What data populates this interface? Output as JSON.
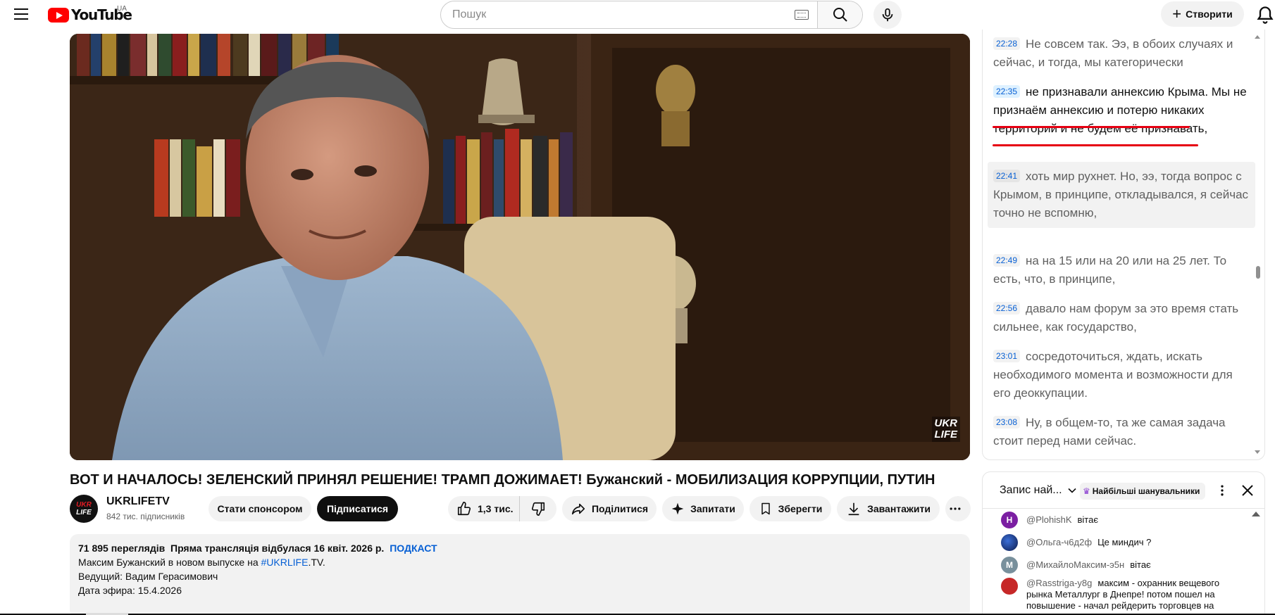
{
  "masthead": {
    "logo_text": "YouTube",
    "country_code": "UA",
    "search_placeholder": "Пошук",
    "create_label": "Створити",
    "icons": [
      "menu-icon",
      "keyboard-icon",
      "search-icon",
      "mic-icon",
      "plus-icon",
      "bell-icon"
    ]
  },
  "video": {
    "title": "ВОТ И НАЧАЛОСЬ! ЗЕЛЕНСКИЙ ПРИНЯЛ РЕШЕНИЕ! ТРАМП ДОЖИМАЕТ! Бужанский - МОБИЛИЗАЦИЯ КОРРУПЦИИ, ПУТИН",
    "watermark_line1": "UKR",
    "watermark_line2": "LIFE"
  },
  "channel": {
    "avatar_line1": "UKR",
    "avatar_line2": "LIFE",
    "name": "UKRLIFETV",
    "subscribers": "842 тис. підписників",
    "sponsor_label": "Стати спонсором",
    "subscribe_label": "Підписатися"
  },
  "actions": {
    "likes": "1,3 тис.",
    "share": "Поділитися",
    "ask": "Запитати",
    "save": "Зберегти",
    "download": "Завантажити"
  },
  "description": {
    "views": "71 895 переглядів",
    "premiere": "Пряма трансляція відбулася 16 квіт. 2026 р.",
    "tag": "ПОДКАСТ",
    "line1_prefix": "Максим Бужанский в новом выпуске на ",
    "line1_link": "#UKRLIFE",
    "line1_suffix": ".TV.",
    "line2": "Ведущий: Вадим Герасимович",
    "line3": "Дата эфира: 15.4.2026"
  },
  "transcript": {
    "segments": [
      {
        "time": "22:28",
        "text": "Не совсем так. Ээ, в обоих случаях и сейчас, и тогда, мы категорически"
      },
      {
        "time": "22:35",
        "text": "не признавали аннексию Крыма. Мы не признаём аннексию и потерю никаких территорий и не будем её признавать,"
      },
      {
        "time": "22:41",
        "text": "хоть мир рухнет. Но, ээ, тогда вопрос с Крымом, в принципе, откладывался, я сейчас точно не вспомню,"
      },
      {
        "time": "22:49",
        "text": "на на 15 или на 20 или на 25 лет. То есть, что, в принципе,"
      },
      {
        "time": "22:56",
        "text": "давало нам форум за это время стать сильнее, как государство,"
      },
      {
        "time": "23:01",
        "text": "сосредоточиться, ждать, искать необходимого момента и возможности для его деоккупации."
      },
      {
        "time": "23:08",
        "text": "Ну, в общем-то, та же самая задача стоит перед нами сейчас."
      }
    ]
  },
  "chat": {
    "mode_label": "Запис най...",
    "filter_label": "Найбільші шанувальники",
    "messages": [
      {
        "initial": "H",
        "color": "#7b1fa2",
        "author": "@PlohishK",
        "text": "вітає"
      },
      {
        "initial": "",
        "color": "#1e3a8a",
        "author": "@Ольга-ч6д2ф",
        "text": "Це миндич ?"
      },
      {
        "initial": "M",
        "color": "#78909c",
        "author": "@МихайлоМаксим-э5н",
        "text": "вітає"
      },
      {
        "initial": "",
        "color": "#c62828",
        "author": "@Rasstriga-y8g",
        "text": "максим - охранник вещевого рынка Металлург в Днепре! потом пошел на повышение - начал рейдерить торговцев на"
      }
    ]
  },
  "colors": {
    "brand_red": "#ff0000",
    "link_blue": "#065fd4",
    "annotation_red": "#e60012"
  }
}
